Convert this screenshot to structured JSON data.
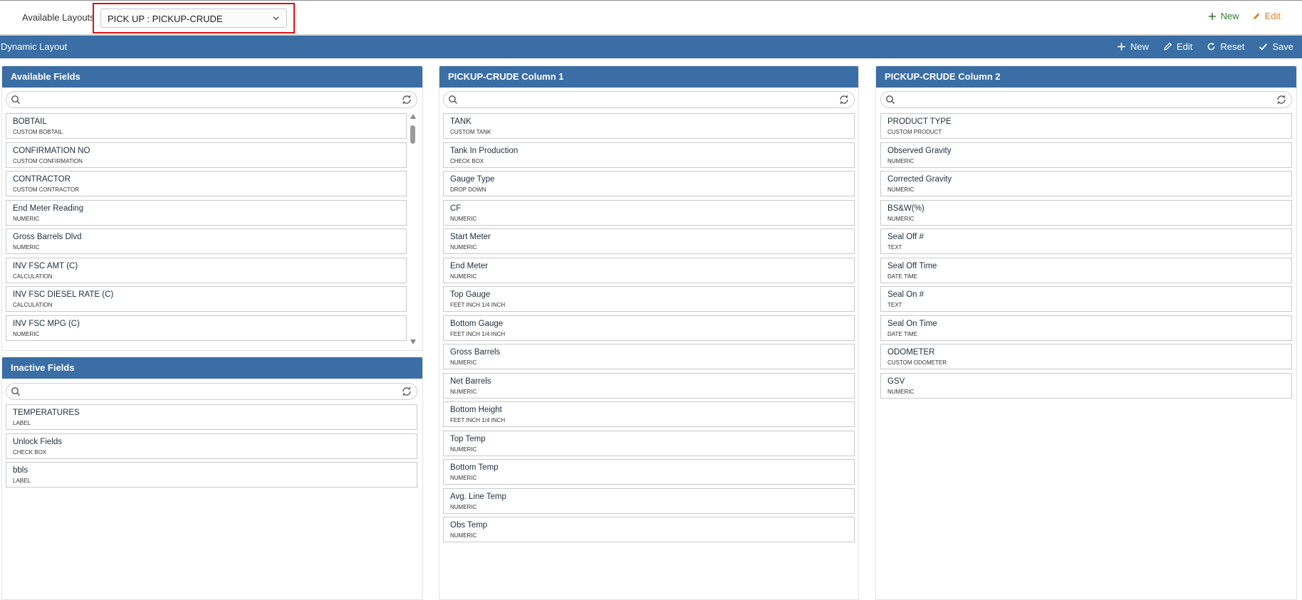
{
  "top": {
    "available_layouts_label": "Available Layouts",
    "selected_layout": "PICK UP : PICKUP-CRUDE",
    "new_label": "New",
    "edit_label": "Edit"
  },
  "dynamic": {
    "title": "Dynamic Layout",
    "new_label": "New",
    "edit_label": "Edit",
    "reset_label": "Reset",
    "save_label": "Save"
  },
  "available_fields": {
    "title": "Available Fields",
    "search_placeholder": "",
    "items": [
      {
        "name": "BOBTAIL",
        "type": "CUSTOM BOBTAIL"
      },
      {
        "name": "CONFIRMATION NO",
        "type": "CUSTOM CONFIRMATION"
      },
      {
        "name": "CONTRACTOR",
        "type": "CUSTOM CONTRACTOR"
      },
      {
        "name": "End Meter Reading",
        "type": "NUMERIC"
      },
      {
        "name": "Gross Barrels Dlvd",
        "type": "NUMERIC"
      },
      {
        "name": "INV FSC AMT (C)",
        "type": "CALCULATION"
      },
      {
        "name": "INV FSC DIESEL RATE (C)",
        "type": "CALCULATION"
      },
      {
        "name": "INV FSC MPG (C)",
        "type": "NUMERIC"
      }
    ]
  },
  "inactive_fields": {
    "title": "Inactive Fields",
    "search_placeholder": "",
    "items": [
      {
        "name": "TEMPERATURES",
        "type": "LABEL"
      },
      {
        "name": "Unlock Fields",
        "type": "CHECK BOX"
      },
      {
        "name": "bbls",
        "type": "LABEL"
      }
    ]
  },
  "column1": {
    "title": "PICKUP-CRUDE Column 1",
    "search_placeholder": "",
    "items": [
      {
        "name": "TANK",
        "type": "CUSTOM TANK"
      },
      {
        "name": "Tank In Production",
        "type": "CHECK BOX"
      },
      {
        "name": "Gauge Type",
        "type": "DROP DOWN"
      },
      {
        "name": "CF",
        "type": "NUMERIC"
      },
      {
        "name": "Start Meter",
        "type": "NUMERIC"
      },
      {
        "name": "End Meter",
        "type": "NUMERIC"
      },
      {
        "name": "Top Gauge",
        "type": "FEET INCH 1/4 INCH"
      },
      {
        "name": "Bottom Gauge",
        "type": "FEET INCH 1/4 INCH"
      },
      {
        "name": "Gross Barrels",
        "type": "NUMERIC"
      },
      {
        "name": "Net Barrels",
        "type": "NUMERIC"
      },
      {
        "name": "Bottom Height",
        "type": "FEET INCH 1/4 INCH"
      },
      {
        "name": "Top Temp",
        "type": "NUMERIC"
      },
      {
        "name": "Bottom Temp",
        "type": "NUMERIC"
      },
      {
        "name": "Avg. Line Temp",
        "type": "NUMERIC"
      },
      {
        "name": "Obs Temp",
        "type": "NUMERIC"
      }
    ]
  },
  "column2": {
    "title": "PICKUP-CRUDE Column 2",
    "search_placeholder": "",
    "items": [
      {
        "name": "PRODUCT TYPE",
        "type": "CUSTOM PRODUCT"
      },
      {
        "name": "Observed Gravity",
        "type": "NUMERIC"
      },
      {
        "name": "Corrected Gravity",
        "type": "NUMERIC"
      },
      {
        "name": "BS&W(%)",
        "type": "NUMERIC"
      },
      {
        "name": "Seal Off #",
        "type": "TEXT"
      },
      {
        "name": "Seal Off Time",
        "type": "DATE TIME"
      },
      {
        "name": "Seal On #",
        "type": "TEXT"
      },
      {
        "name": "Seal On Time",
        "type": "DATE TIME"
      },
      {
        "name": "ODOMETER",
        "type": "CUSTOM ODOMETER"
      },
      {
        "name": "GSV",
        "type": "NUMERIC"
      }
    ]
  }
}
